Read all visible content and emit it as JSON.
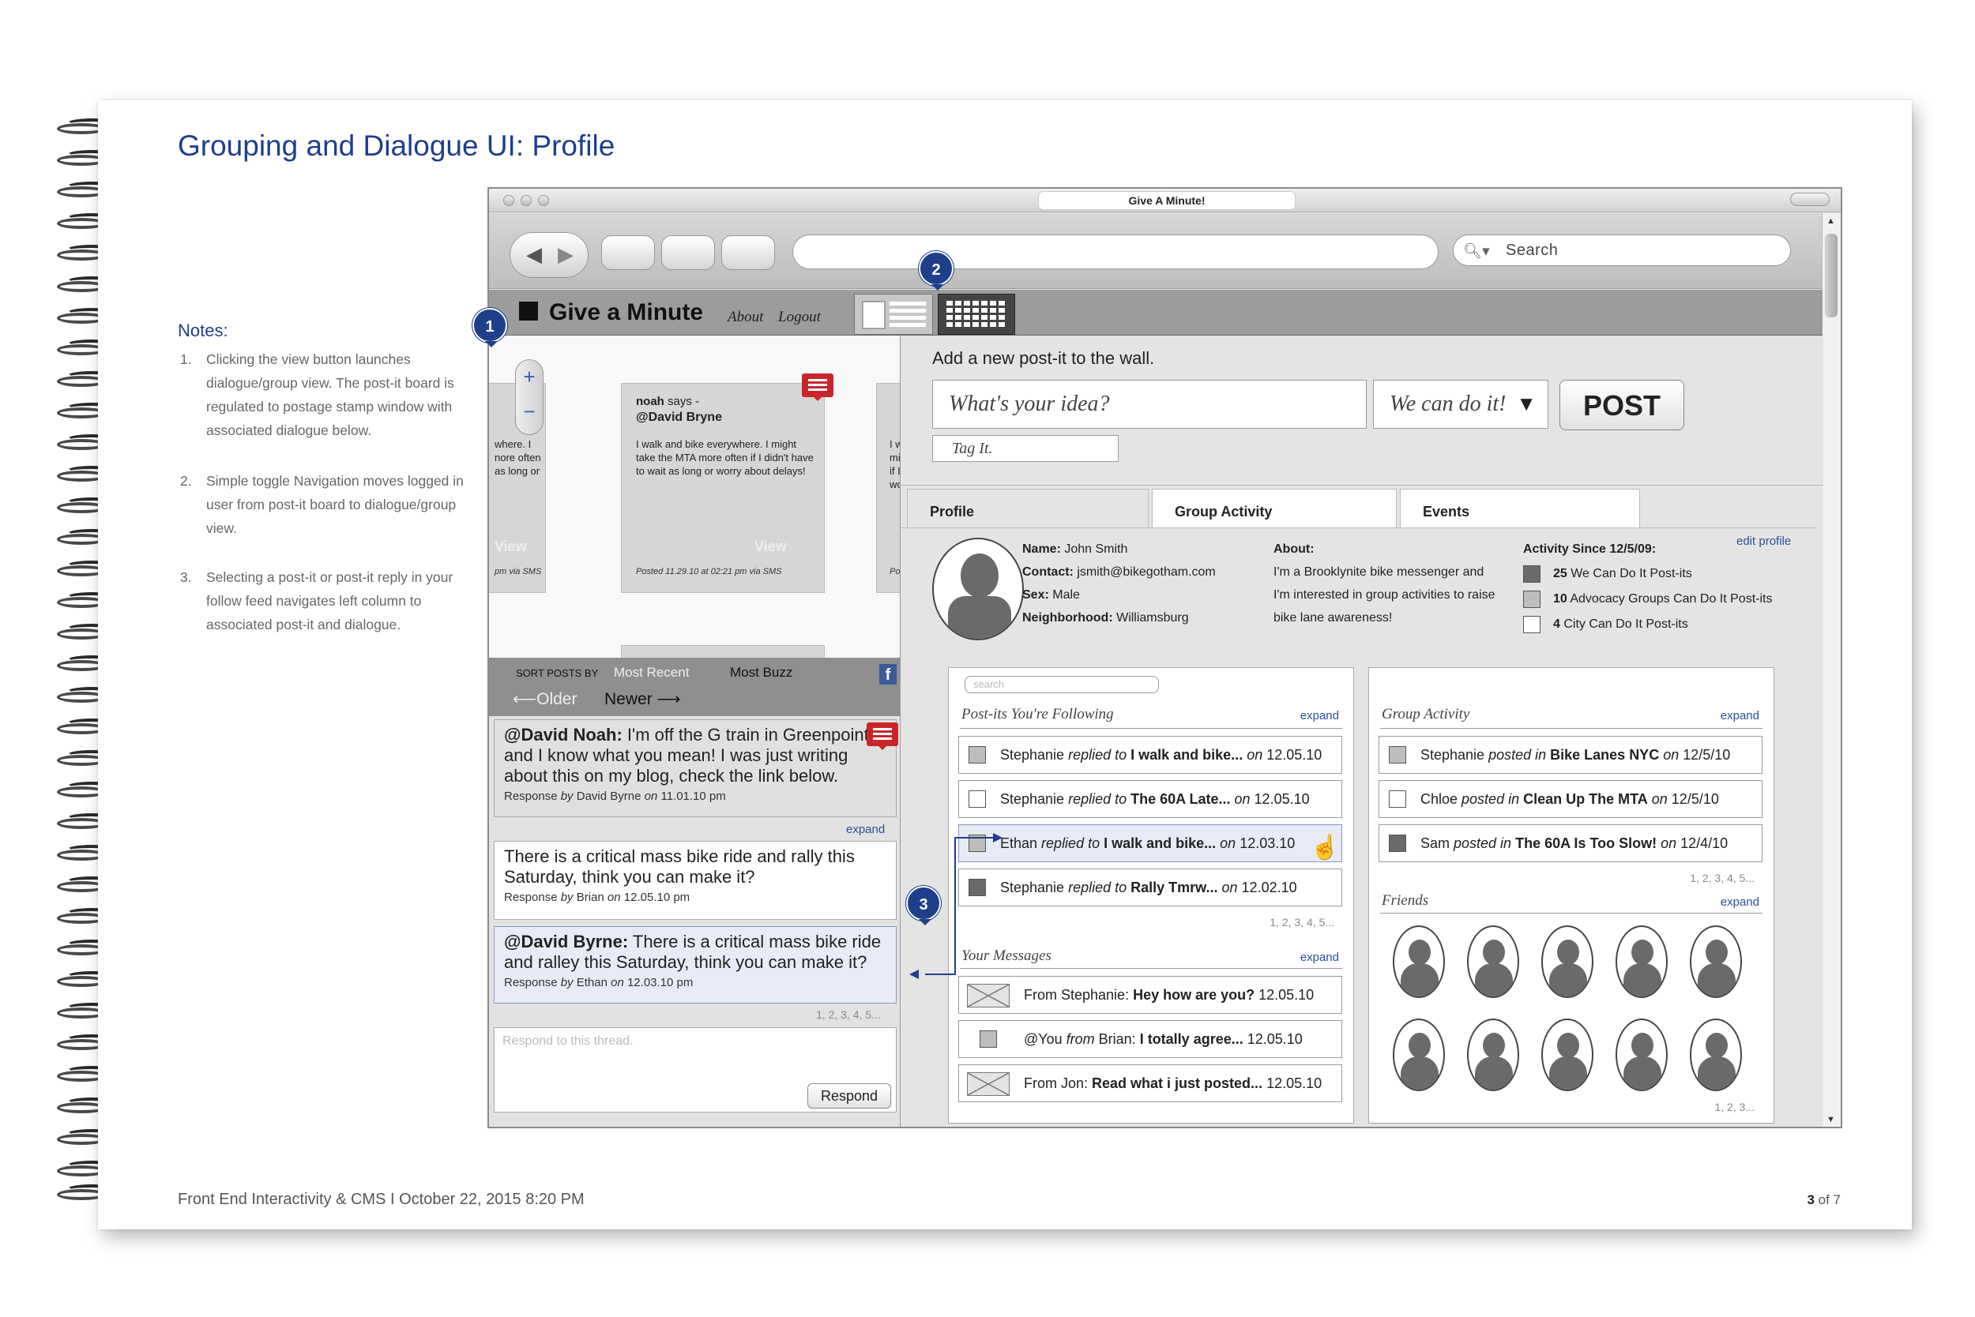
{
  "document": {
    "title": "Grouping and Dialogue UI: Profile",
    "notes_title": "Notes:",
    "notes": [
      {
        "num": "1.",
        "text": "Clicking the view button launches dialogue/group view. The post-it board is regulated to postage stamp window with associated dialogue below."
      },
      {
        "num": "2.",
        "text": "Simple toggle Navigation moves logged in user from post-it board to dialogue/group view."
      },
      {
        "num": "3.",
        "text": "Selecting a post-it or post-it reply in your follow feed navigates left column to associated post-it and dialogue."
      }
    ],
    "footer_left": "Front End Interactivity & CMS  I October 22, 2015 8:20 PM",
    "footer_page": "3",
    "footer_of": " of 7"
  },
  "window": {
    "title": "Give A Minute!",
    "search_placeholder": "Search"
  },
  "app": {
    "logo": "Give a Minute",
    "about": "About",
    "logout": "Logout"
  },
  "badges": {
    "b1": "1",
    "b2": "2",
    "b3": "3"
  },
  "board": {
    "left_card_text": "where. I\nnore often\nas long or",
    "left_card_view": "View",
    "left_card_via": "pm via SMS",
    "center_author": "noah",
    "center_says": " says -",
    "center_to": "@David Bryne",
    "center_text": "I walk and bike everywhere. I might take the MTA more often if I didn't have to wait as long or worry about delays!",
    "center_view": "View",
    "center_posted": "Posted 11.29.10 at 02:21 pm via SMS",
    "right_card_text": "I w\nmi\nif I\nwo",
    "right_card_via": "Po"
  },
  "sort": {
    "label": "SORT POSTS BY",
    "most_recent": "Most Recent",
    "most_buzz": "Most Buzz",
    "older": "Older",
    "newer": "Newer",
    "fb": "f"
  },
  "thread": {
    "main_to": "@David Noah:",
    "main_text": " I'm off the G train in Greenpoint and I know what you mean! I was just writing about this on my blog, check the link below.",
    "main_meta_pre": "Response ",
    "main_meta_by": "by",
    "main_meta_name": " David Byrne ",
    "main_meta_on": "on",
    "main_meta_date": " 11.01.10 pm",
    "expand": "expand",
    "r1_text": "There is a critical mass bike ride and rally this Saturday, think you can make it?",
    "r1_meta_name": " Brian ",
    "r1_meta_date": " 12.05.10 pm",
    "r2_to": "@David Byrne:",
    "r2_text": " There is a critical mass bike ride and ralley this Saturday, think you can make it?",
    "r2_meta_name": " Ethan ",
    "r2_meta_date": " 12.03.10 pm",
    "pager": "1, 2, 3, 4, 5...",
    "respond_placeholder": "Respond to this thread.",
    "respond_button": "Respond"
  },
  "composer": {
    "heading": "Add a new post-it to the wall.",
    "idea_placeholder": "What's your idea?",
    "category": "We can do it!",
    "post_button": "POST",
    "tag_placeholder": "Tag It."
  },
  "tabs": [
    "Profile",
    "Group Activity",
    "Events"
  ],
  "profile": {
    "name_label": "Name:",
    "name": " John Smith",
    "contact_label": "Contact:",
    "contact": " jsmith@bikegotham.com",
    "sex_label": "Sex:",
    "sex": " Male",
    "hood_label": "Neighborhood:",
    "hood": " Williamsburg",
    "about_label": "About:",
    "about_text": "I'm a Brooklynite bike messenger and I'm interested in group activities to raise bike lane awareness!",
    "activity_label": "Activity Since 12/5/09:",
    "activity": [
      {
        "count": "25",
        "text": " We Can Do It Post-its",
        "fill": "#6a6a6a"
      },
      {
        "count": "10",
        "text": " Advocacy Groups Can Do It Post-its",
        "fill": "#bdbdbd"
      },
      {
        "count": "4",
        "text": " City Can Do It Post-its",
        "fill": "#ffffff"
      }
    ],
    "edit": "edit profile"
  },
  "following": {
    "search_placeholder": "search",
    "heading": "Post-its You're Following",
    "expand": "expand",
    "rows": [
      {
        "who": "Stephanie ",
        "verb": "replied to",
        "what": " I walk and bike...",
        "on": " on",
        "date": " 12.05.10",
        "fill": "#bdbdbd"
      },
      {
        "who": "Stephanie ",
        "verb": "replied to",
        "what": " The 60A Late...",
        "on": " on",
        "date": " 12.05.10",
        "fill": "#ffffff"
      },
      {
        "who": "Ethan ",
        "verb": "replied to",
        "what": " I walk and bike...",
        "on": " on",
        "date": " 12.03.10",
        "fill": "#bdbdbd"
      },
      {
        "who": "Stephanie ",
        "verb": "replied to",
        "what": " Rally Tmrw...",
        "on": " on",
        "date": " 12.02.10",
        "fill": "#6a6a6a"
      }
    ],
    "pager": "1, 2, 3, 4, 5..."
  },
  "messages": {
    "heading": "Your Messages",
    "expand": "expand",
    "rows": [
      {
        "from": "From Stephanie: ",
        "subject": "Hey how are you?",
        "date": " 12.05.10"
      },
      {
        "from": "@You ",
        "from_i": "from",
        "from2": " Brian: ",
        "subject": "I totally agree...",
        "date": " 12.05.10"
      },
      {
        "from": "From Jon: ",
        "subject": "Read what i just posted...",
        "date": " 12.05.10"
      }
    ]
  },
  "group_activity": {
    "heading": "Group Activity",
    "expand": "expand",
    "rows": [
      {
        "who": "Stephanie ",
        "verb": "posted in",
        "what": " Bike Lanes NYC",
        "on": " on",
        "date": " 12/5/10",
        "fill": "#bdbdbd"
      },
      {
        "who": "Chloe ",
        "verb": "posted in",
        "what": " Clean Up The MTA",
        "on": " on",
        "date": " 12/5/10",
        "fill": "#ffffff"
      },
      {
        "who": "Sam ",
        "verb": "posted in",
        "what": " The 60A Is Too Slow!",
        "on": " on",
        "date": " 12/4/10",
        "fill": "#6a6a6a"
      }
    ],
    "pager": "1, 2, 3, 4, 5..."
  },
  "friends": {
    "heading": "Friends",
    "expand": "expand",
    "pager": "1, 2, 3..."
  },
  "colors": {
    "accent": "#1e3f8f",
    "badge": "#1f3f8a",
    "alert": "#c8262a",
    "highlight_row": "#e6ebf5"
  }
}
